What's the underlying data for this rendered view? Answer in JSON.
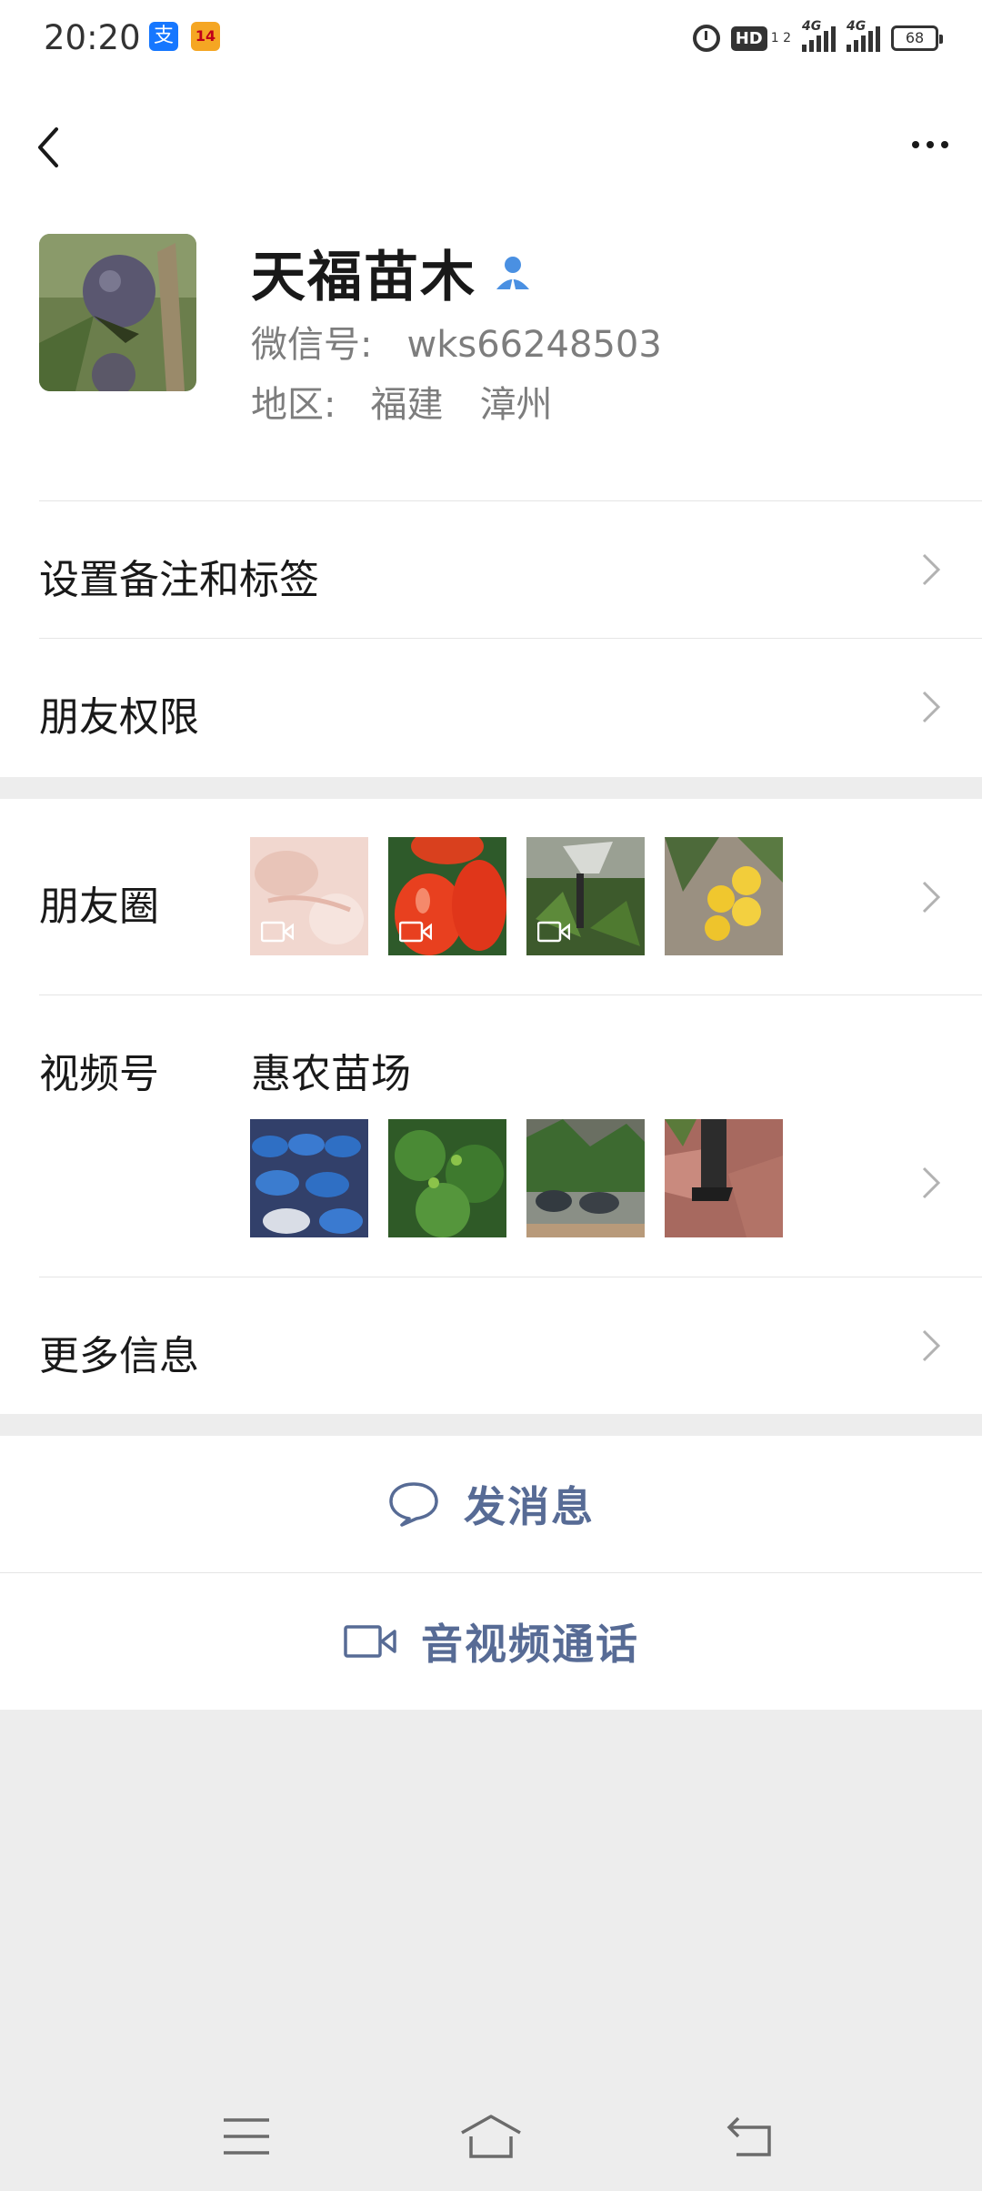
{
  "status_bar": {
    "time": "20:20",
    "alipay_icon": "支",
    "app2_icon": "14",
    "hd_label": "HD",
    "hd_sub": "1 2",
    "sim1_label": "4G",
    "sim2_label": "4G",
    "battery": "68"
  },
  "header": {
    "back_icon": "chevron-left-icon",
    "more_icon": "more-dots-icon"
  },
  "profile": {
    "name": "天福苗木",
    "badge_icon": "person-verified-icon",
    "wechat_id_label": "微信号:",
    "wechat_id": "wks66248503",
    "region_label": "地区:",
    "region_province": "福建",
    "region_city": "漳州"
  },
  "rows": {
    "remark": "设置备注和标签",
    "permissions": "朋友权限",
    "moments": "朋友圈",
    "channels": "视频号",
    "channels_name": "惠农苗场",
    "more_info": "更多信息"
  },
  "actions": {
    "message": "发消息",
    "call": "音视频通话"
  },
  "colors": {
    "accent_link": "#576b95",
    "badge_blue": "#4a90e2",
    "background": "#ededed",
    "card": "#ffffff"
  }
}
